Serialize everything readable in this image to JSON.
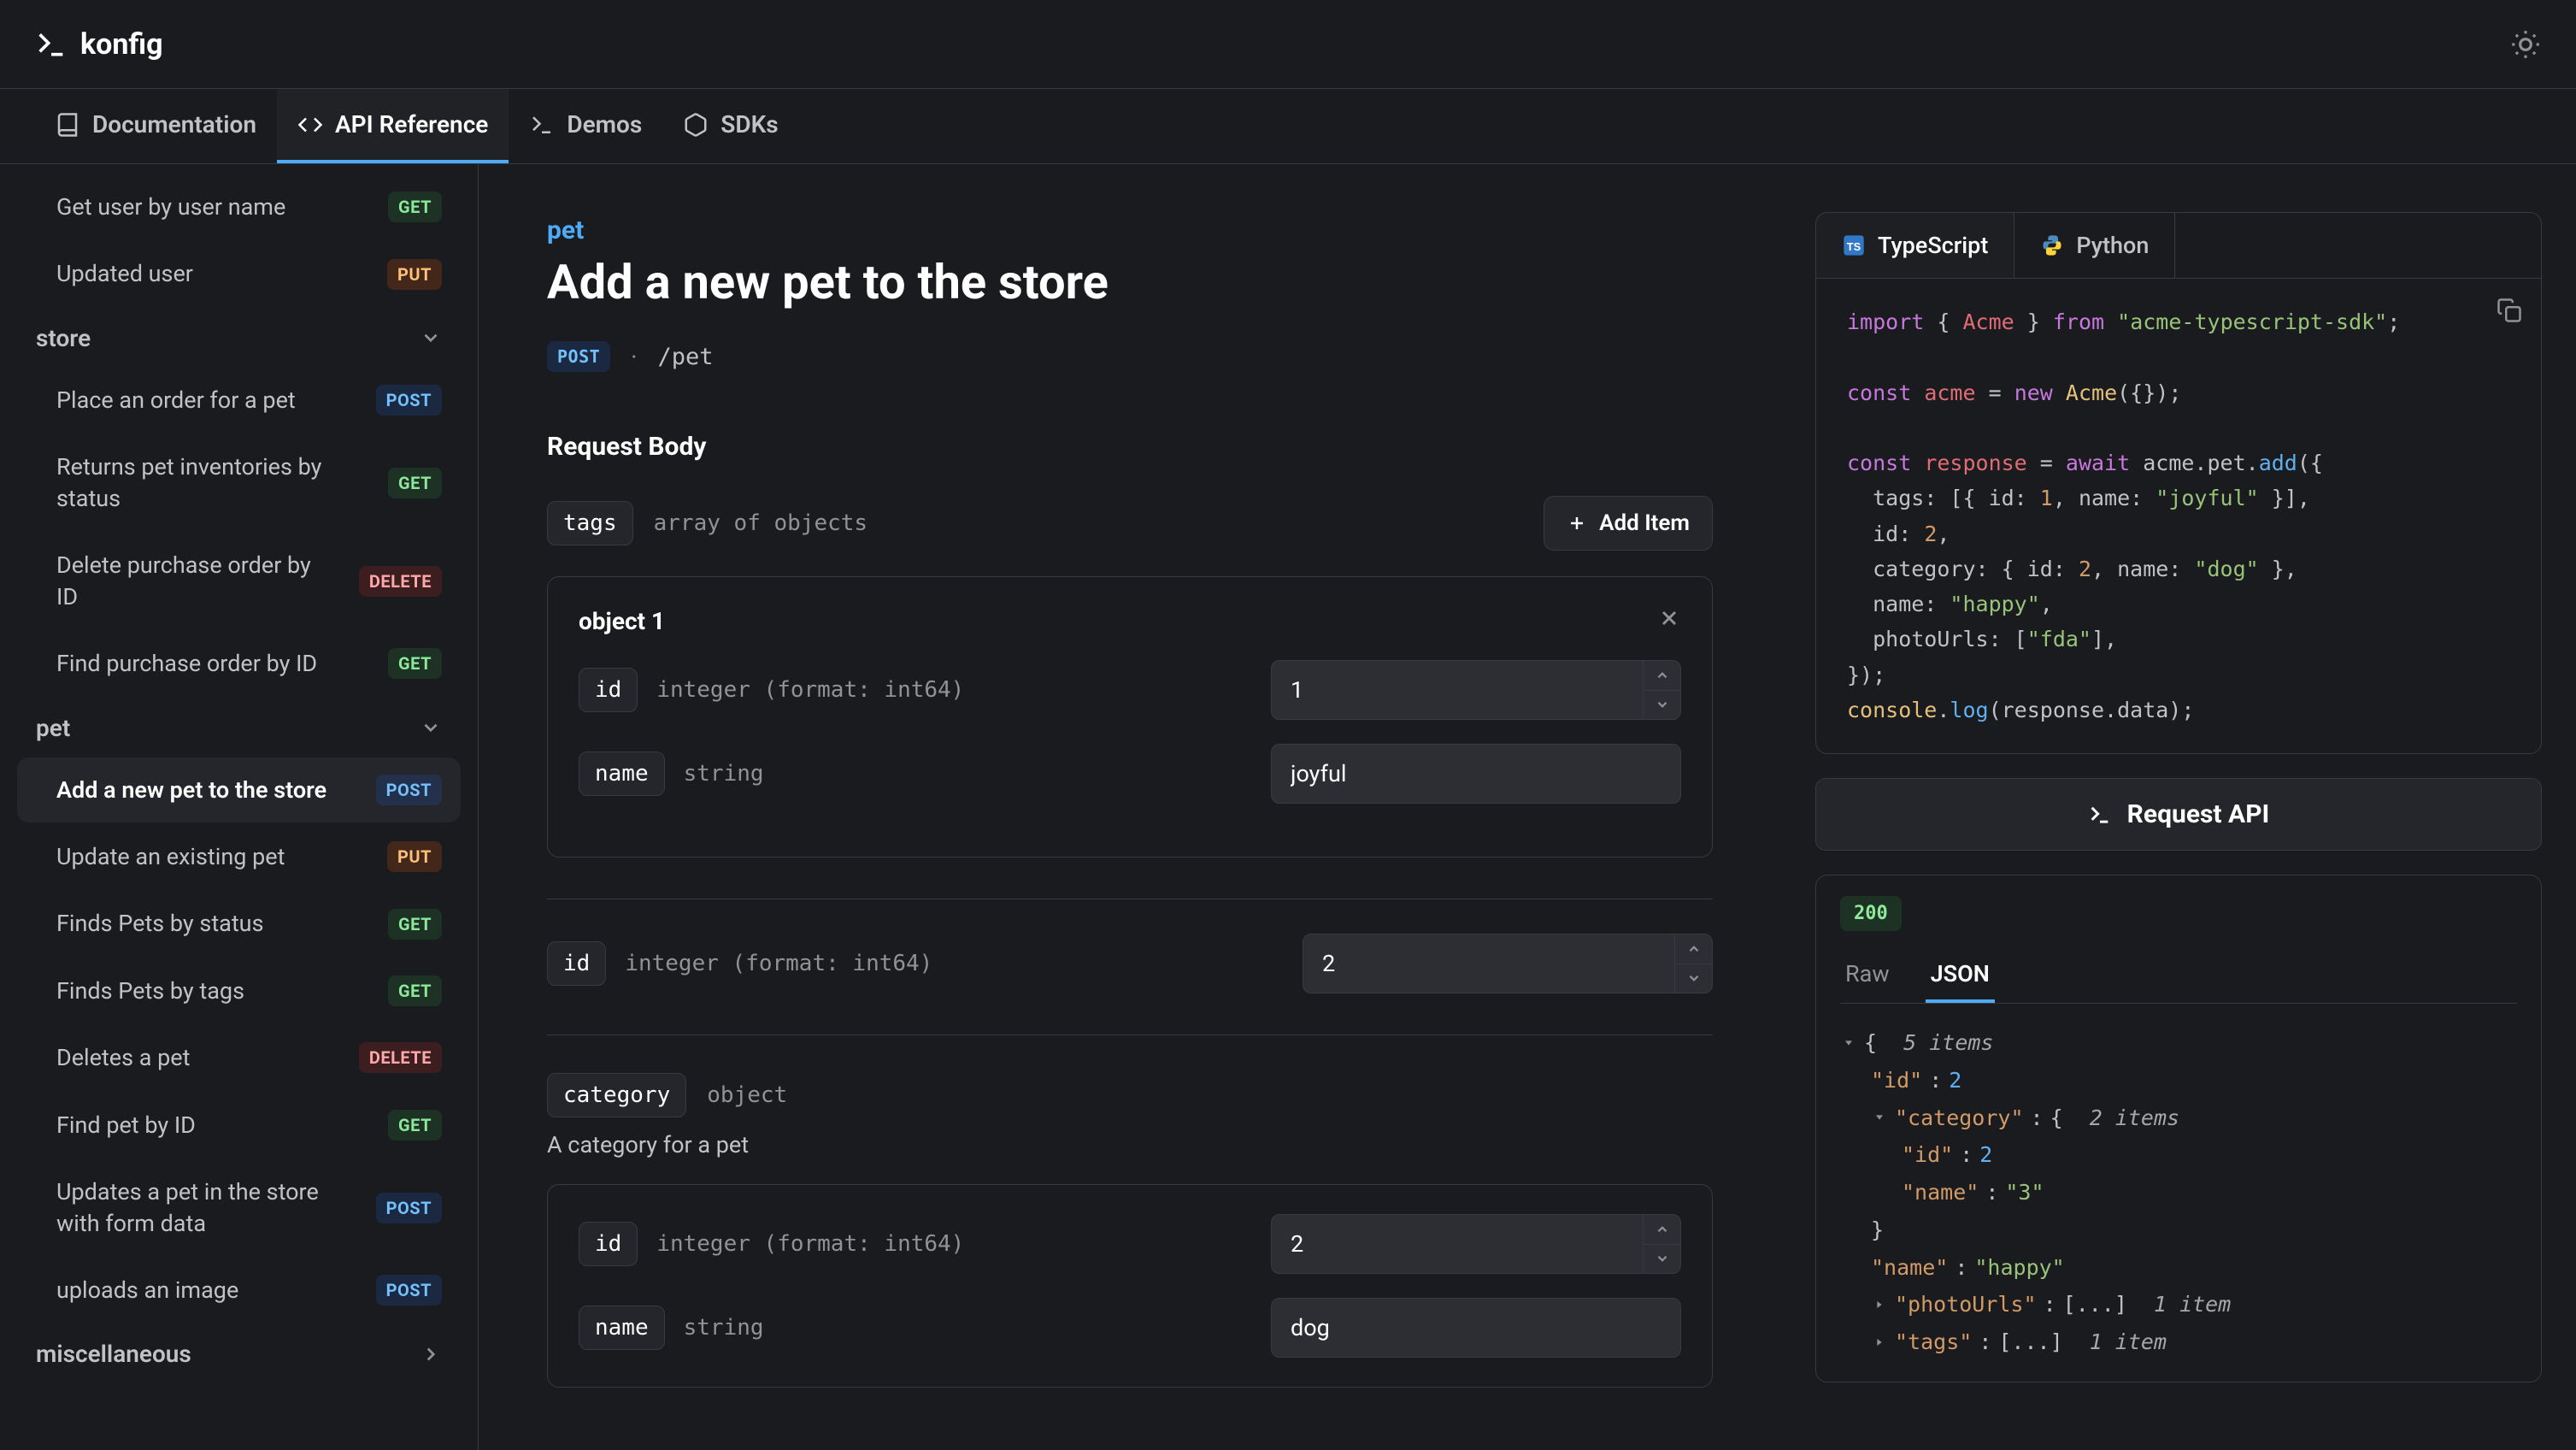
{
  "brand": "konfig",
  "nav": {
    "documentation": "Documentation",
    "api_reference": "API Reference",
    "demos": "Demos",
    "sdks": "SDKs"
  },
  "sidebar": {
    "items": [
      {
        "label": "Get user by user name",
        "method": "GET"
      },
      {
        "label": "Updated user",
        "method": "PUT"
      }
    ],
    "store": {
      "label": "store",
      "items": [
        {
          "label": "Place an order for a pet",
          "method": "POST"
        },
        {
          "label": "Returns pet inventories by status",
          "method": "GET"
        },
        {
          "label": "Delete purchase order by ID",
          "method": "DELETE"
        },
        {
          "label": "Find purchase order by ID",
          "method": "GET"
        }
      ]
    },
    "pet": {
      "label": "pet",
      "items": [
        {
          "label": "Add a new pet to the store",
          "method": "POST"
        },
        {
          "label": "Update an existing pet",
          "method": "PUT"
        },
        {
          "label": "Finds Pets by status",
          "method": "GET"
        },
        {
          "label": "Finds Pets by tags",
          "method": "GET"
        },
        {
          "label": "Deletes a pet",
          "method": "DELETE"
        },
        {
          "label": "Find pet by ID",
          "method": "GET"
        },
        {
          "label": "Updates a pet in the store with form data",
          "method": "POST"
        },
        {
          "label": "uploads an image",
          "method": "POST"
        }
      ]
    },
    "misc": {
      "label": "miscellaneous"
    }
  },
  "page": {
    "breadcrumb": "pet",
    "title": "Add a new pet to the store",
    "method": "POST",
    "path_sep": "·",
    "path": "/pet",
    "section_request_body": "Request Body",
    "add_item": "Add Item",
    "params": {
      "tags": {
        "name": "tags",
        "type": "array of objects"
      },
      "id": {
        "name": "id",
        "type": "integer (format: int64)"
      },
      "name": {
        "name": "name",
        "type": "string"
      },
      "category": {
        "name": "category",
        "type": "object",
        "desc": "A category for a pet"
      }
    },
    "object1": {
      "title": "object 1",
      "id_value": "1",
      "name_value": "joyful"
    },
    "root_id_value": "2",
    "cat_id_value": "2",
    "cat_name_value": "dog"
  },
  "code": {
    "tabs": {
      "ts": "TypeScript",
      "py": "Python"
    },
    "ts": {
      "l1_import": "import",
      "l1_brace_open": "{ ",
      "l1_sym": "Acme",
      "l1_brace_close": " }",
      "l1_from": "from",
      "l1_pkg": "\"acme-typescript-sdk\"",
      "l1_semi": ";",
      "l3_const": "const",
      "l3_acme": "acme",
      "l3_eq": " = ",
      "l3_new": "new",
      "l3_ctor": " Acme",
      "l3_paren": "({});",
      "l5_const": "const",
      "l5_resp": "response",
      "l5_eq": " = ",
      "l5_await": "await",
      "l5_call": " acme.pet.",
      "l5_add": "add",
      "l5_open": "({",
      "l6": "  tags: [{ id: ",
      "l6_n1": "1",
      "l6_mid": ", name: ",
      "l6_s": "\"joyful\"",
      "l6_end": " }],",
      "l7": "  id: ",
      "l7_n": "2",
      "l7_end": ",",
      "l8": "  category: { id: ",
      "l8_n": "2",
      "l8_mid": ", name: ",
      "l8_s": "\"dog\"",
      "l8_end": " },",
      "l9": "  name: ",
      "l9_s": "\"happy\"",
      "l9_end": ",",
      "l10": "  photoUrls: [",
      "l10_s": "\"fda\"",
      "l10_end": "],",
      "l11": "});",
      "l12_a": "console",
      "l12_b": ".",
      "l12_c": "log",
      "l12_d": "(response.data);"
    }
  },
  "request_btn": "Request API",
  "response": {
    "status": "200",
    "tab_raw": "Raw",
    "tab_json": "JSON",
    "root_open": "{",
    "root_meta": "5 items",
    "id_key": "\"id\"",
    "colon": " : ",
    "id_val": "2",
    "cat_key": "\"category\"",
    "cat_open": "{",
    "cat_meta": "2 items",
    "cat_id_key": "\"id\"",
    "cat_id_val": "2",
    "cat_name_key": "\"name\"",
    "cat_name_val": "\"3\"",
    "cat_close": "}",
    "name_key": "\"name\"",
    "name_val": "\"happy\"",
    "photo_key": "\"photoUrls\"",
    "arr_collapsed": "[...]",
    "photo_meta": "1 item",
    "tags_key": "\"tags\"",
    "tags_meta": "1 item"
  }
}
